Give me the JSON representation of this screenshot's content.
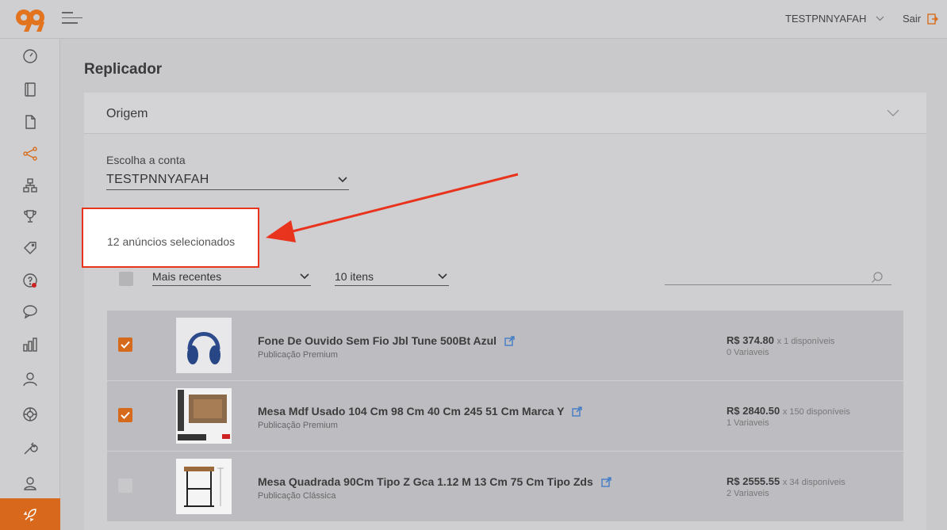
{
  "header": {
    "account_name": "TESTPNNYAFAH",
    "logout_label": "Sair"
  },
  "sidebar": {
    "items": [
      {
        "icon": "dashboard-icon"
      },
      {
        "icon": "notebook-icon"
      },
      {
        "icon": "file-icon"
      },
      {
        "icon": "share-icon",
        "active": true
      },
      {
        "icon": "hierarchy-icon"
      },
      {
        "icon": "trophy-icon"
      },
      {
        "icon": "tag-icon"
      },
      {
        "icon": "question-icon",
        "badge": true
      },
      {
        "icon": "chat-icon"
      },
      {
        "icon": "bar-chart-icon"
      },
      {
        "icon": "users-icon"
      },
      {
        "icon": "lifebuoy-icon"
      },
      {
        "icon": "wrench-icon"
      },
      {
        "icon": "user-icon"
      },
      {
        "icon": "rocket-icon",
        "highlight": true
      }
    ]
  },
  "page": {
    "title": "Replicador",
    "panel_title": "Origem",
    "account_label": "Escolha a conta",
    "account_value": "TESTPNNYAFAH",
    "selected_text": "12 anúncios selecionados",
    "sort_value": "Mais recentes",
    "count_value": "10 itens",
    "search_placeholder": ""
  },
  "listings": [
    {
      "title": "Fone De Ouvido Sem Fio Jbl Tune 500Bt Azul",
      "type": "Publicação Premium",
      "price": "R$ 374.80",
      "availability": "x 1 disponíveis",
      "variations": "0 Variaveis",
      "checked": true
    },
    {
      "title": "Mesa Mdf Usado 104 Cm 98 Cm 40 Cm 245 51 Cm Marca Y",
      "type": "Publicação Premium",
      "price": "R$ 2840.50",
      "availability": "x 150 disponíveis",
      "variations": "1 Variaveis",
      "checked": true
    },
    {
      "title": "Mesa Quadrada 90Cm Tipo Z Gca 1.12 M 13 Cm 75 Cm Tipo Zds",
      "type": "Publicação Clássica",
      "price": "R$ 2555.55",
      "availability": "x 34 disponíveis",
      "variations": "2 Variaveis",
      "checked": false
    }
  ],
  "colors": {
    "accent": "#d86e1c",
    "annotation": "#e8341d"
  }
}
